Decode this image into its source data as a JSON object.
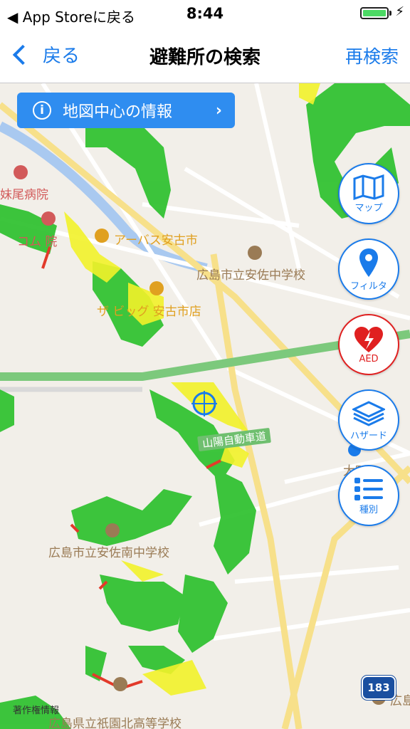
{
  "status_bar": {
    "back_app": "◀ App Storeに戻る",
    "time": "8:44",
    "battery_icon": "battery-full-icon"
  },
  "nav": {
    "back_label": "戻る",
    "title": "避難所の検索",
    "research_label": "再検索"
  },
  "info_button": {
    "label": "地図中心の情報"
  },
  "side_buttons": [
    {
      "id": "map",
      "label": "マップ",
      "icon": "map-icon"
    },
    {
      "id": "filter",
      "label": "フィルタ",
      "icon": "pin-icon"
    },
    {
      "id": "aed",
      "label": "AED",
      "icon": "aed-heart-icon"
    },
    {
      "id": "hazard",
      "label": "ハザード",
      "icon": "layers-icon"
    },
    {
      "id": "kind",
      "label": "種別",
      "icon": "list-icon"
    }
  ],
  "map_labels": {
    "hospital_1": "妹尾病院",
    "hospital_2": "コム  院",
    "aeon": "アーバス安古市",
    "school_1": "広島市立安佐中学校",
    "store": "ザ  ビッグ 安古市店",
    "expressway": "山陽自動車道",
    "place_1": "大町",
    "school_2": "広島市立安佐南中学校",
    "route": "183",
    "copyright": "著作権情報",
    "school_3": "広島県立祇園北高等学校",
    "place_2": "広島"
  },
  "colors": {
    "accent": "#1a7bea",
    "aed": "#e02020",
    "hazard_green": "#33c233",
    "hazard_yellow": "#f2f22a",
    "expressway": "#7cc97c"
  }
}
